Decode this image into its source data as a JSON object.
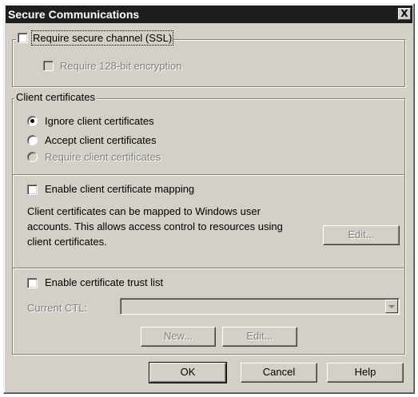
{
  "window": {
    "title": "Secure Communications",
    "close_glyph": "X"
  },
  "ssl": {
    "require_label": "Require secure channel (SSL)",
    "require_checked": false,
    "enc_label": "Require 128-bit encryption",
    "enc_checked": false
  },
  "client_certs": {
    "group_label": "Client certificates",
    "options": [
      {
        "label": "Ignore client certificates",
        "selected": true,
        "enabled": true
      },
      {
        "label": "Accept client certificates",
        "selected": false,
        "enabled": true
      },
      {
        "label": "Require client certificates",
        "selected": false,
        "enabled": false
      }
    ],
    "mapping_label": "Enable client certificate mapping",
    "mapping_checked": false,
    "mapping_desc_lines": [
      "Client certificates can be mapped to Windows user",
      "accounts.  This allows access control to resources using",
      "client certificates."
    ],
    "mapping_edit_label": "Edit...",
    "ctl_label": "Enable certificate trust list",
    "ctl_checked": false,
    "current_ctl_label": "Current CTL:",
    "current_ctl_value": "",
    "new_label": "New...",
    "ctl_edit_label": "Edit..."
  },
  "buttons": {
    "ok": "OK",
    "cancel": "Cancel",
    "help": "Help"
  }
}
